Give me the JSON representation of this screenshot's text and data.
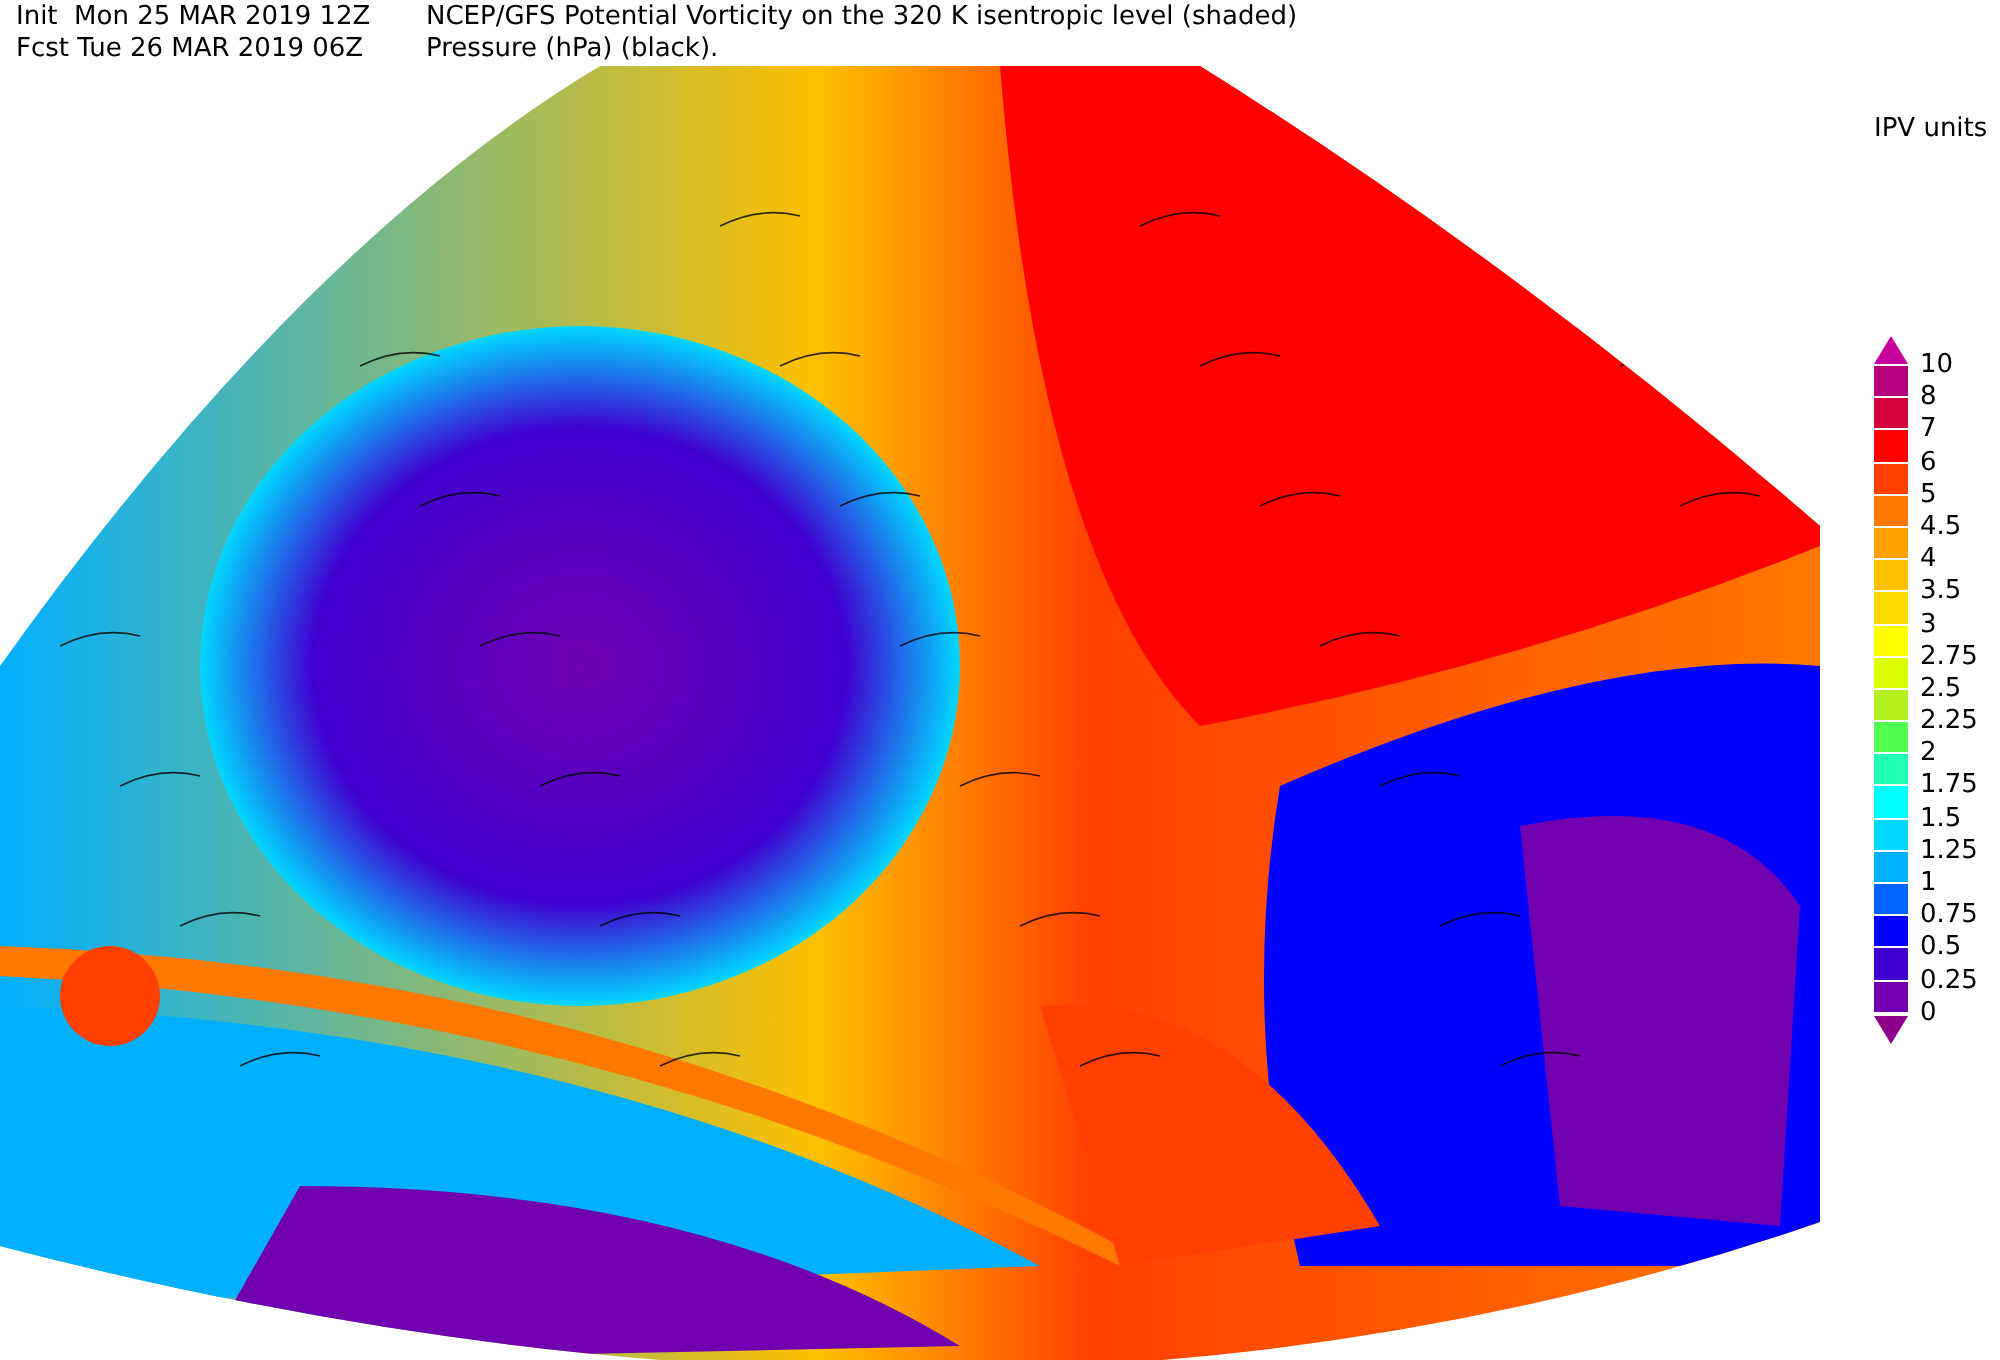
{
  "header": {
    "lines": [
      {
        "left": "Init  Mon 25 MAR 2019 12Z",
        "right": "NCEP/GFS Potential Vorticity on the 320 K isentropic level (shaded)"
      },
      {
        "left": "Fcst Tue 26 MAR 2019 06Z",
        "right": "Pressure (hPa) (black)."
      }
    ]
  },
  "legend": {
    "title": "IPV units",
    "segments": [
      {
        "kind": "arrow-up",
        "color": "#c8009c"
      },
      {
        "color": "#b4007c"
      },
      {
        "color": "#d2003c"
      },
      {
        "color": "#ff0000"
      },
      {
        "color": "#ff4000"
      },
      {
        "color": "#ff7800"
      },
      {
        "color": "#ffa000"
      },
      {
        "color": "#ffc000"
      },
      {
        "color": "#ffdc00"
      },
      {
        "color": "#ffff00"
      },
      {
        "color": "#dcff00"
      },
      {
        "color": "#b4f020"
      },
      {
        "color": "#50ff50"
      },
      {
        "color": "#20ffb4"
      },
      {
        "color": "#00ffff"
      },
      {
        "color": "#00d8ff"
      },
      {
        "color": "#00b0ff"
      },
      {
        "color": "#0064ff"
      },
      {
        "color": "#0000ff"
      },
      {
        "color": "#4000d0"
      },
      {
        "color": "#7000b0"
      },
      {
        "kind": "arrow-down",
        "color": "#8c008c"
      }
    ],
    "labels": [
      "10",
      "8",
      "7",
      "6",
      "5",
      "4.5",
      "4",
      "3.5",
      "3",
      "2.75",
      "2.5",
      "2.25",
      "2",
      "1.75",
      "1.5",
      "1.25",
      "1",
      "0.75",
      "0.5",
      "0.25",
      "0"
    ]
  }
}
